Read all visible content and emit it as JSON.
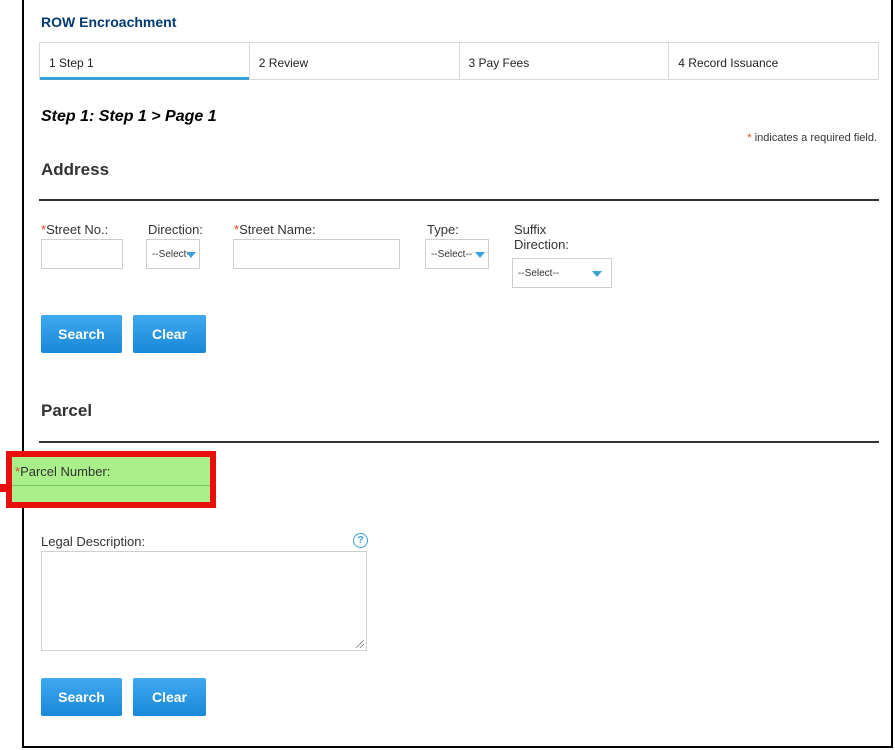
{
  "app": {
    "title": "ROW Encroachment"
  },
  "steps": [
    {
      "num": "1",
      "label": "Step 1"
    },
    {
      "num": "2",
      "label": "Review"
    },
    {
      "num": "3",
      "label": "Pay Fees"
    },
    {
      "num": "4",
      "label": "Record Issuance"
    }
  ],
  "page": {
    "heading": "Step 1: Step 1 > Page 1",
    "required_star": "*",
    "required_note": "indicates a required field."
  },
  "address": {
    "title": "Address",
    "street_no_label": "Street No.:",
    "direction_label": "Direction:",
    "direction_value": "--Select--",
    "street_name_label": "Street Name:",
    "type_label": "Type:",
    "type_value": "--Select--",
    "suffix_label_1": "Suffix",
    "suffix_label_2": "Direction:",
    "suffix_value": "--Select--",
    "search_label": "Search",
    "clear_label": "Clear"
  },
  "parcel": {
    "title": "Parcel",
    "parcel_number_label": "Parcel Number:",
    "legal_description_label": "Legal Description:",
    "help_glyph": "?",
    "search_label": "Search",
    "clear_label": "Clear"
  },
  "colors": {
    "accent": "#3aa1d8",
    "button": "#1a88d8",
    "required": "#e0441e",
    "highlight_border": "#e8100d",
    "highlight_fill": "#a9f08a",
    "title": "#003a70"
  }
}
